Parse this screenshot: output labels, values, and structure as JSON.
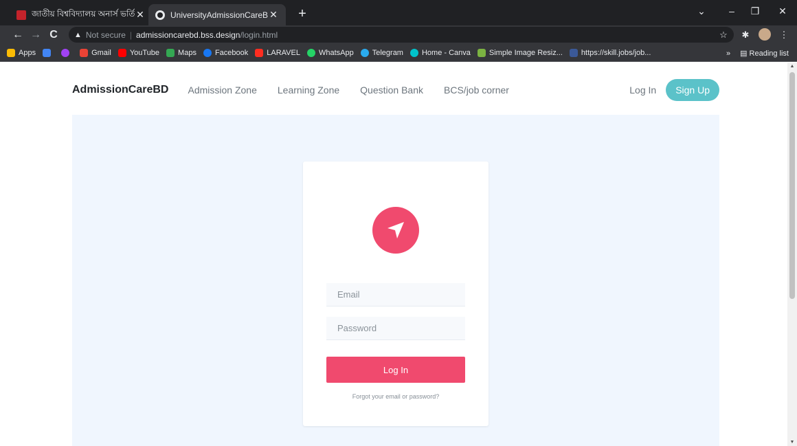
{
  "browser": {
    "tabs": [
      {
        "title": "জাতীয় বিশ্ববিদ্যালয় অনার্স ভর্তি বি",
        "active": false
      },
      {
        "title": "UniversityAdmissionCareBD",
        "active": true
      }
    ],
    "new_tab": "+",
    "address": {
      "security": "Not secure",
      "host": "admissioncarebd.bss.design",
      "path": "/login.html"
    },
    "bookmarks": [
      {
        "label": "Apps",
        "color": "#fbbc05"
      },
      {
        "label": "",
        "color": "#4285f4"
      },
      {
        "label": "",
        "color": "#a142f4"
      },
      {
        "label": "Gmail",
        "color": "#ea4335"
      },
      {
        "label": "YouTube",
        "color": "#ff0000"
      },
      {
        "label": "Maps",
        "color": "#34a853"
      },
      {
        "label": "Facebook",
        "color": "#1877f2"
      },
      {
        "label": "LARAVEL",
        "color": "#ff2d20"
      },
      {
        "label": "WhatsApp",
        "color": "#25d366"
      },
      {
        "label": "Telegram",
        "color": "#2aabee"
      },
      {
        "label": "Home - Canva",
        "color": "#00c4cc"
      },
      {
        "label": "Simple Image Resiz...",
        "color": "#7cb342"
      },
      {
        "label": "https://skill.jobs/job...",
        "color": "#3b5998"
      }
    ],
    "overflow": "»",
    "reading_list": "Reading list"
  },
  "site": {
    "brand": "AdmissionCareBD",
    "nav": [
      "Admission Zone",
      "Learning Zone",
      "Question Bank",
      "BCS/job corner"
    ],
    "login_link": "Log In",
    "signup": "Sign Up"
  },
  "login": {
    "email_placeholder": "Email",
    "password_placeholder": "Password",
    "submit": "Log In",
    "forgot": "Forgot your email or password?"
  },
  "colors": {
    "accent": "#f04a6e",
    "signup": "#5bc2c9",
    "hero_bg": "#f0f6fe"
  }
}
